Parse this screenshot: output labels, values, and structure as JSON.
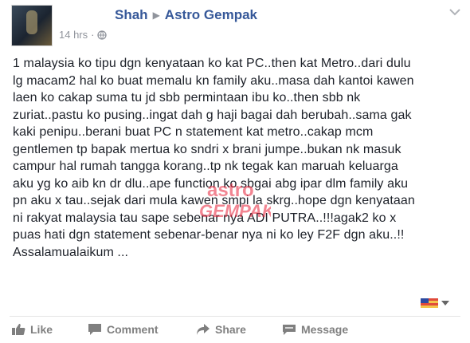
{
  "header": {
    "author": "Shah",
    "page": "Astro Gempak",
    "time": "14 hrs",
    "separator": "·"
  },
  "post": {
    "text": "1 malaysia ko tipu dgn kenyataan ko kat PC..then kat Metro..dari dulu\nlg macam2 hal ko buat memalu kn family aku..masa dah kantoi kawen\nlaen ko cakap suma tu jd sbb permintaan ibu ko..then sbb nk\nzuriat..pastu ko pusing..ingat dah g haji bagai dah berubah..sama gak\nkaki penipu..berani buat PC n statement kat metro..cakap mcm\ngentlemen tp bapak mertua ko sndri x brani jumpe..bukan nk masuk\ncampur hal rumah tangga korang..tp nk tegak kan maruah keluarga\naku yg ko aib kn dr dlu..ape function ko sbgai abg ipar dlm family aku\npn aku x tau..sejak dari mula kawen smpi la skrg..hope dgn kenyataan\nni rakyat malaysia tau sape sebenar nya ADI PUTRA..!!!agak2 ko x\npuas hati dgn statement sebenar-benar nya ni ko ley F2F dgn aku..!!\nAssalamualaikum ..."
  },
  "watermark": {
    "line1": "astro",
    "line2": "GEMPAK",
    "color": "#e8233a"
  },
  "actions": {
    "like": "Like",
    "comment": "Comment",
    "share": "Share",
    "message": "Message"
  },
  "colors": {
    "link": "#365899",
    "muted": "#90949c",
    "action": "#7f7f7f"
  }
}
